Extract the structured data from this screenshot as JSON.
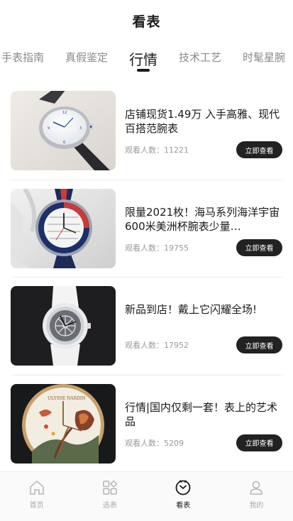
{
  "header": {
    "title": "看表"
  },
  "tabs": [
    {
      "label": "手表指南"
    },
    {
      "label": "真假鉴定"
    },
    {
      "label": "行情"
    },
    {
      "label": "技术工艺"
    },
    {
      "label": "时髦星腕"
    }
  ],
  "active_tab_index": 2,
  "feed": {
    "items": [
      {
        "title": "店铺现货1.49万 入手高雅、现代百搭范腕表",
        "views_label": "观看人数：",
        "views": "11221",
        "button_label": "立即查看",
        "image_icon": "watch-white-dial-photo"
      },
      {
        "title": "限量2021枚！海马系列海洋宇宙600米美洲杯腕表少量…",
        "views_label": "观看人数：",
        "views": "19755",
        "button_label": "立即查看",
        "image_icon": "seamaster-blue-bezel-photo"
      },
      {
        "title": "新品到店！戴上它闪耀全场!",
        "views_label": "观看人数：",
        "views": "17952",
        "button_label": "立即查看",
        "image_icon": "skeleton-diamond-watch-photo"
      },
      {
        "title": "行情|国内仅剩一套！表上的艺术品",
        "views_label": "观看人数：",
        "views": "5209",
        "button_label": "立即查看",
        "image_icon": "enamel-bird-dial-photo"
      }
    ]
  },
  "tabbar": {
    "items": [
      {
        "label": "首页",
        "icon": "home-icon"
      },
      {
        "label": "选表",
        "icon": "grid-icon"
      },
      {
        "label": "看表",
        "icon": "watch-icon",
        "active": true
      },
      {
        "label": "我的",
        "icon": "person-icon"
      }
    ]
  },
  "colors": {
    "accent": "#222222",
    "muted": "#9a9a9a",
    "divider": "#eeeeee"
  }
}
